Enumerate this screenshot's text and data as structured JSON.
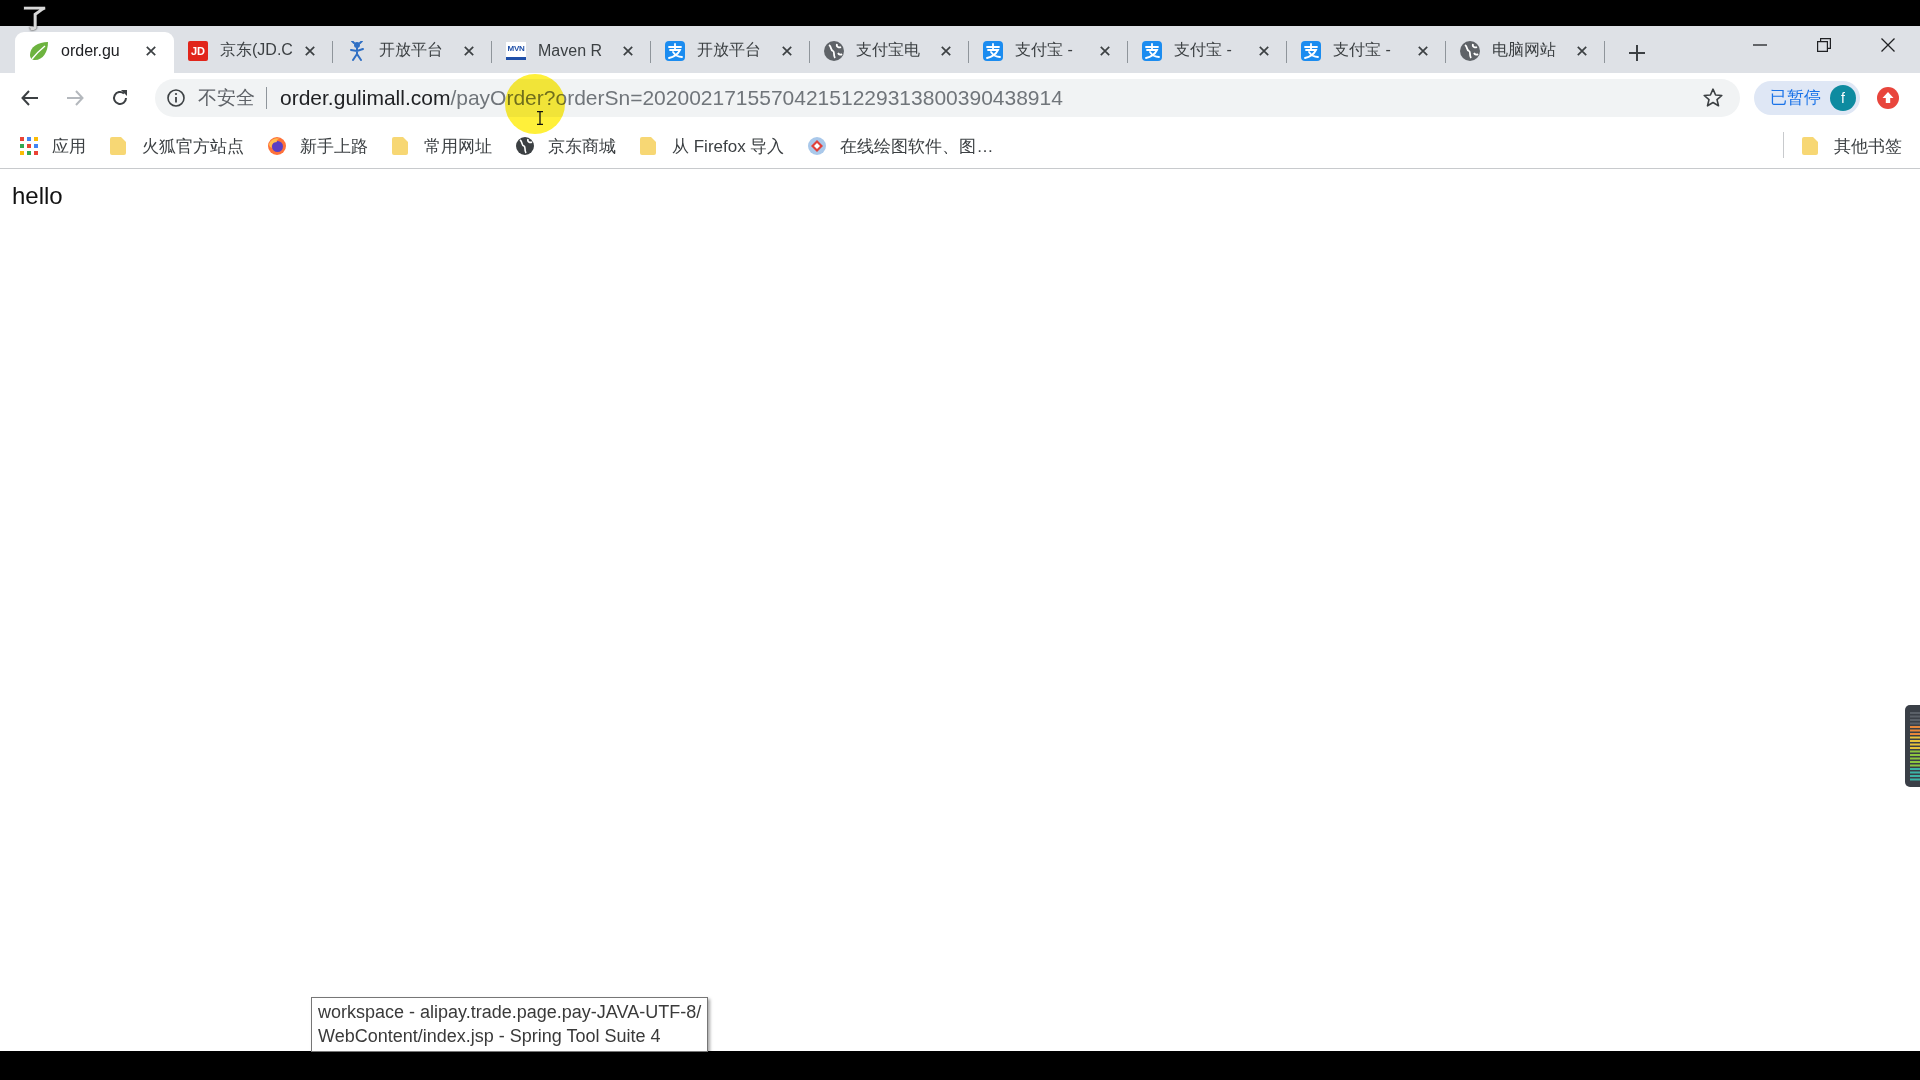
{
  "caption": {
    "text": "了"
  },
  "tabs": [
    {
      "title": "order.gu",
      "kind": "leaf",
      "selected": true
    },
    {
      "title": "京东(JD.C",
      "kind": "tile",
      "icon_text": "JD",
      "color": "#e1251b",
      "selected": false
    },
    {
      "title": "开放平台",
      "kind": "figure",
      "selected": false
    },
    {
      "title": "Maven R",
      "kind": "wordmark",
      "icon_text": "MVN",
      "color": "#1f4fa8",
      "selected": false
    },
    {
      "title": "开放平台",
      "kind": "script",
      "selected": false
    },
    {
      "title": "支付宝电",
      "kind": "globe",
      "selected": false
    },
    {
      "title": "支付宝 -",
      "kind": "script",
      "selected": false
    },
    {
      "title": "支付宝 -",
      "kind": "script",
      "selected": false
    },
    {
      "title": "支付宝 -",
      "kind": "script",
      "selected": false
    },
    {
      "title": "电脑网站",
      "kind": "globe",
      "selected": false
    }
  ],
  "toolbar": {
    "nav": [
      {
        "kind": "back",
        "disabled": false
      },
      {
        "kind": "forward",
        "disabled": true
      },
      {
        "kind": "reload",
        "disabled": false
      }
    ],
    "security_label": "不安全",
    "url_host": "order.gulimall.com",
    "url_path": "/payOrder?orderSn=202002171557042151229313800390438914",
    "profile_status": "已暂停",
    "avatar_letter": "f"
  },
  "bookmarks": {
    "items": [
      {
        "label": "应用",
        "kind": "apps"
      },
      {
        "label": "火狐官方站点",
        "kind": "folder"
      },
      {
        "label": "新手上路",
        "kind": "fox"
      },
      {
        "label": "常用网址",
        "kind": "folder"
      },
      {
        "label": "京东商城",
        "kind": "globe"
      },
      {
        "label": "从 Firefox 导入",
        "kind": "folder"
      },
      {
        "label": "在线绘图软件、图…",
        "kind": "diamond"
      }
    ],
    "other": {
      "label": "其他书签",
      "kind": "folder"
    }
  },
  "page": {
    "text": "hello"
  },
  "tooltip": {
    "lines": [
      "workspace - alipay.trade.page.pay-JAVA-UTF-8/",
      "WebContent/index.jsp - Spring Tool Suite 4"
    ]
  }
}
